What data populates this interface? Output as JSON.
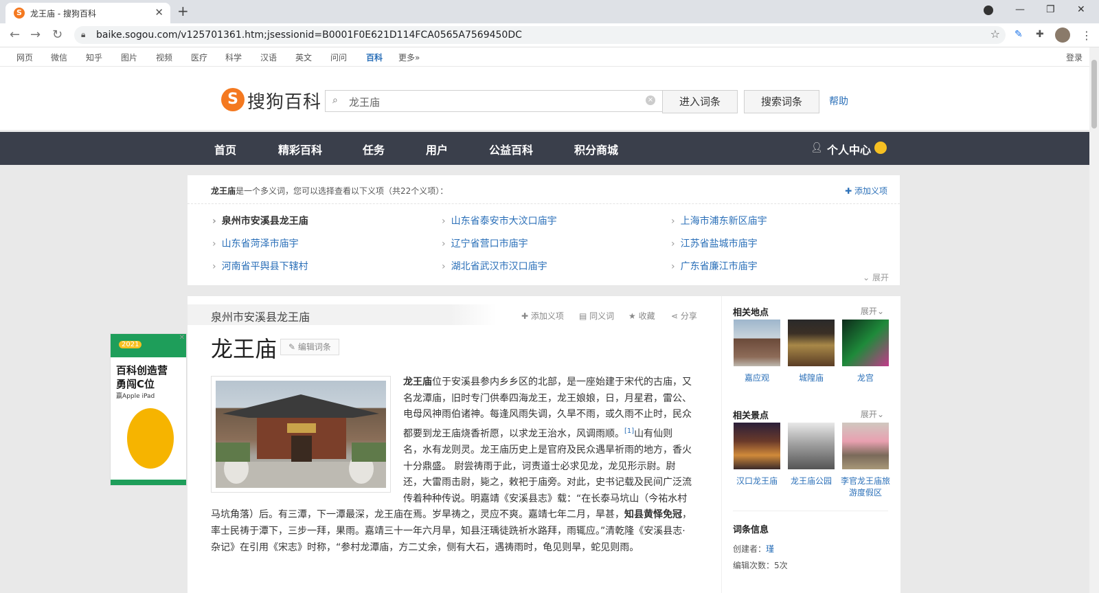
{
  "browser": {
    "tab_title": "龙王庙 - 搜狗百科",
    "tab_favicon": "S",
    "url": "baike.sogou.com/v125701361.htm;jsessionid=B0001F0E621D114FCA0565A7569450DC"
  },
  "site_nav": {
    "items": [
      "网页",
      "微信",
      "知乎",
      "图片",
      "视频",
      "医疗",
      "科学",
      "汉语",
      "英文",
      "问问",
      "百科",
      "更多»"
    ],
    "current": "百科",
    "login": "登录"
  },
  "header": {
    "logo_text": "搜狗百科",
    "search_value": "龙王庙",
    "enter_button": "进入词条",
    "search_button": "搜索词条",
    "help": "帮助"
  },
  "main_nav": {
    "items": [
      "首页",
      "精彩百科",
      "任务",
      "用户",
      "公益百科",
      "积分商城"
    ],
    "user_center": "个人中心"
  },
  "disambiguation": {
    "term": "龙王庙",
    "intro": "是一个多义词，您可以选择查看以下义项（共22个义项）：",
    "add_sense": "添加义项",
    "links": [
      "泉州市安溪县龙王庙",
      "山东省泰安市大汶口庙宇",
      "上海市浦东新区庙宇",
      "山东省菏泽市庙宇",
      "辽宁省营口市庙宇",
      "江苏省盐城市庙宇",
      "河南省平舆县下辖村",
      "湖北省武汉市汉口庙宇",
      "广东省廉江市庙宇"
    ],
    "expand": "展开"
  },
  "article": {
    "subtitle": "泉州市安溪县龙王庙",
    "actions": [
      "添加义项",
      "同义词",
      "收藏",
      "分享"
    ],
    "title": "龙王庙",
    "edit": "编辑词条",
    "body_lead": "龙王庙",
    "body_1": "位于安溪县参内乡乡区的北部，是一座始建于宋代的古庙，又名龙潭庙，旧时专门供奉四海龙王，龙王娘娘，日，月星君，雷公、电母风神雨伯诸神。每逢风雨失调，久旱不雨，或久雨不止时，民众都要到龙王庙烧香祈愿，以求龙王治水，风调雨顺。",
    "cite": "[1]",
    "body_2": "山有仙则名，水有龙则灵。龙王庙历史上是官府及民众遇旱祈雨的地方，香火十分鼎盛。 尉尝祷雨于此，诃责道士必求见龙，龙见形示尉。尉还，大雷雨击尉，毙之，敕祀于庙旁。对此，史书记载及民间广泛流传着种种传说。明嘉靖《安溪县志》载：“在长泰马坑山（今祐水村马坑角落）后。有三潭，下一潭最深，龙王庙在焉。岁旱祷之，灵应不爽。嘉靖七年二月，旱甚，",
    "body_bold": "知县黄怿免冠",
    "body_3": "，率士民祷于潭下，三步一拜，果雨。嘉靖三十一年六月旱，知县汪瑀徒跣祈水路拜，雨辄应。”清乾隆《安溪县志·杂记》在引用《宋志》时称，“参村龙潭庙，方二丈余，侧有大石，遇祷雨时，龟见则旱，蛇见则雨。"
  },
  "ad": {
    "year": "2021",
    "line1": "百科创造营",
    "line2": "勇闯C位",
    "line3": "赢Apple iPad"
  },
  "sidebar": {
    "places_title": "相关地点",
    "places_more": "展开",
    "places": [
      "嘉应观",
      "城隍庙",
      "龙宫"
    ],
    "scenic_title": "相关景点",
    "scenic_more": "展开",
    "scenic": [
      "汉口龙王庙",
      "龙王庙公园",
      "李官龙王庙旅游度假区"
    ],
    "info_title": "词条信息",
    "creator_label": "创建者：",
    "creator": "瑾",
    "edits_label": "编辑次数：",
    "edits": "5次"
  }
}
